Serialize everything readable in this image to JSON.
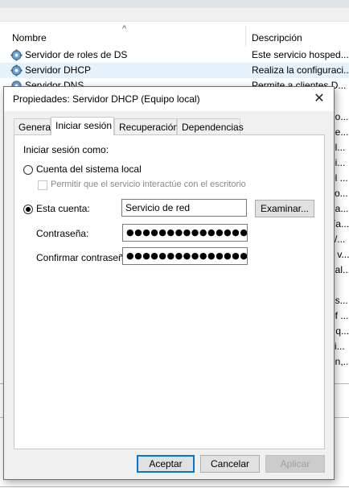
{
  "services_list": {
    "columns": {
      "name": "Nombre",
      "description": "Descripción"
    },
    "rows": [
      {
        "name": "Servidor de roles de DS",
        "description": "Este servicio hosped..."
      },
      {
        "name": "Servidor DHCP",
        "description": "Realiza la configuraci..."
      },
      {
        "name": "Servidor DNS",
        "description": "Permite a clientes D..."
      }
    ],
    "right_fragments": [
      "no...",
      "de...",
      "el ...",
      "ni...",
      "el...",
      "so...",
      "da...",
      "ría...",
      "s/...",
      "y v...",
      "ual...",
      "us...",
      "of ...",
      "r q...",
      "ci...",
      "on,..."
    ]
  },
  "dialog": {
    "title": "Propiedades: Servidor DHCP (Equipo local)",
    "close_glyph": "✕",
    "tabs": [
      "General",
      "Iniciar sesión",
      "Recuperación",
      "Dependencias"
    ],
    "active_tab": "Iniciar sesión",
    "logon": {
      "heading": "Iniciar sesión como:",
      "local_system_label": "Cuenta del sistema local",
      "interact_label": "Permitir que el servicio interactúe con el escritorio",
      "this_account_label": "Esta cuenta:",
      "account_value": "Servicio de red",
      "browse_label": "Examinar...",
      "password_label": "Contraseña:",
      "password_value": "●●●●●●●●●●●●●●●",
      "confirm_label": "Confirmar contraseña:",
      "confirm_value": "●●●●●●●●●●●●●●●",
      "selected_option": "this_account"
    },
    "buttons": {
      "ok": "Aceptar",
      "cancel": "Cancelar",
      "apply": "Aplicar"
    }
  }
}
